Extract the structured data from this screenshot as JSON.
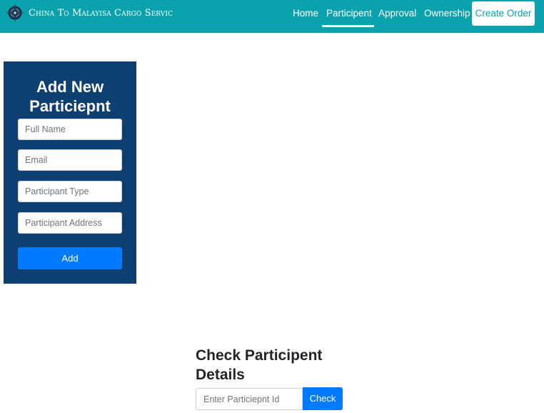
{
  "navbar": {
    "brand_text": "China To Malayisa Cargo Servic",
    "brand_icon": "compass-logo-icon",
    "links": [
      {
        "label": "Home",
        "active": false
      },
      {
        "label": "Participent",
        "active": true
      },
      {
        "label": "Approval",
        "active": false
      },
      {
        "label": "Ownership",
        "active": false
      }
    ],
    "cta_label": "Create Order",
    "accent_color": "#0aa3ad"
  },
  "add_form": {
    "title": "Add New Particiepnt",
    "fields": [
      {
        "placeholder": "Full Name",
        "value": ""
      },
      {
        "placeholder": "Email",
        "value": ""
      },
      {
        "placeholder": "Participant Type",
        "value": ""
      },
      {
        "placeholder": "Participant Address",
        "value": ""
      }
    ],
    "submit_label": "Add",
    "panel_color": "#0d3f73",
    "button_color": "#007bff"
  },
  "check_form": {
    "title": "Check Participent Details",
    "input_placeholder": "Enter Particiepnt Id",
    "input_value": "",
    "button_label": "Check"
  }
}
